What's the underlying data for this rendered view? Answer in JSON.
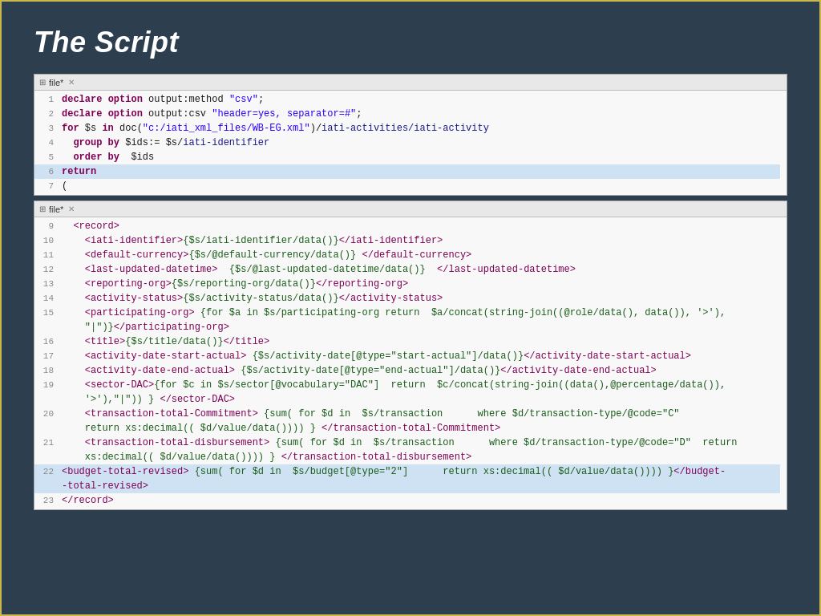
{
  "slide": {
    "title": "The Script",
    "border_color": "#c8b84a"
  },
  "editor1": {
    "tab_label": "file*",
    "tab_close": "✕",
    "lines": [
      {
        "num": 1,
        "text": "declare option output:method \"csv\";",
        "highlight": false
      },
      {
        "num": 2,
        "text": "declare option output:csv \"header=yes, separator=#\";",
        "highlight": false
      },
      {
        "num": 3,
        "text": "for $s in doc(\"c:/iati_xml_files/WB-EG.xml\")/iati-activities/iati-activity",
        "highlight": false
      },
      {
        "num": 4,
        "text": "  group by $ids:= $s/iati-identifier",
        "highlight": false
      },
      {
        "num": 5,
        "text": "  order by  $ids",
        "highlight": false
      },
      {
        "num": 6,
        "text": "return",
        "highlight": true
      },
      {
        "num": 7,
        "text": "(",
        "highlight": false
      }
    ]
  },
  "editor2": {
    "tab_label": "file*",
    "tab_close": "✕",
    "lines": [
      {
        "num": 9,
        "text": "  <record>",
        "highlight": false
      },
      {
        "num": 10,
        "text": "    <iati-identifier>{$s/iati-identifier/data()}</iati-identifier>",
        "highlight": false
      },
      {
        "num": 11,
        "text": "    <default-currency>{$s/@default-currency/data()} </default-currency>",
        "highlight": false
      },
      {
        "num": 12,
        "text": "    <last-updated-datetime>  {$s/@last-updated-datetime/data()}  </last-updated-datetime>",
        "highlight": false
      },
      {
        "num": 13,
        "text": "    <reporting-org>{$s/reporting-org/data()}</reporting-org>",
        "highlight": false
      },
      {
        "num": 14,
        "text": "    <activity-status>{$s/activity-status/data()}</activity-status>",
        "highlight": false
      },
      {
        "num": 15,
        "text": "    <participating-org> {for $a in $s/participating-org return  $a/concat(string-join((@role/data(), data()), '>'),",
        "highlight": false
      },
      {
        "num": -1,
        "text": "\"|\")}</participating-org>",
        "highlight": false
      },
      {
        "num": 16,
        "text": "    <title>{$s/title/data()}</title>",
        "highlight": false
      },
      {
        "num": 17,
        "text": "    <activity-date-start-actual> {$s/activity-date[@type=\"start-actual\"]/data()}</activity-date-start-actual>",
        "highlight": false
      },
      {
        "num": 18,
        "text": "    <activity-date-end-actual> {$s/activity-date[@type=\"end-actual\"]/data()}</activity-date-end-actual>",
        "highlight": false
      },
      {
        "num": 19,
        "text": "    <sector-DAC>{for $c in $s/sector[@vocabulary=\"DAC\"]  return  $c/concat(string-join((data(),@percentage/data()),",
        "highlight": false
      },
      {
        "num": -1,
        "text": "'>'),\"|\")) } </sector-DAC>",
        "highlight": false
      },
      {
        "num": 20,
        "text": "    <transaction-total-Commitment> {sum( for $d in  $s/transaction      where $d/transaction-type/@code=\"C\"",
        "highlight": false
      },
      {
        "num": -1,
        "text": "return xs:decimal(( $d/value/data()))) } </transaction-total-Commitment>",
        "highlight": false
      },
      {
        "num": 21,
        "text": "    <transaction-total-disbursement> {sum( for $d in  $s/transaction      where $d/transaction-type/@code=\"D\"  return",
        "highlight": false
      },
      {
        "num": -1,
        "text": "xs:decimal(( $d/value/data()))) } </transaction-total-disbursement>",
        "highlight": false
      },
      {
        "num": 22,
        "text": "<budget-total-revised> {sum( for $d in  $s/budget[@type=\"2\"]      return xs:decimal(( $d/value/data()))) }</budget-",
        "highlight": true
      },
      {
        "num": -1,
        "text": "-total-revised>",
        "highlight": true
      },
      {
        "num": 23,
        "text": "</record>",
        "highlight": false
      }
    ]
  }
}
